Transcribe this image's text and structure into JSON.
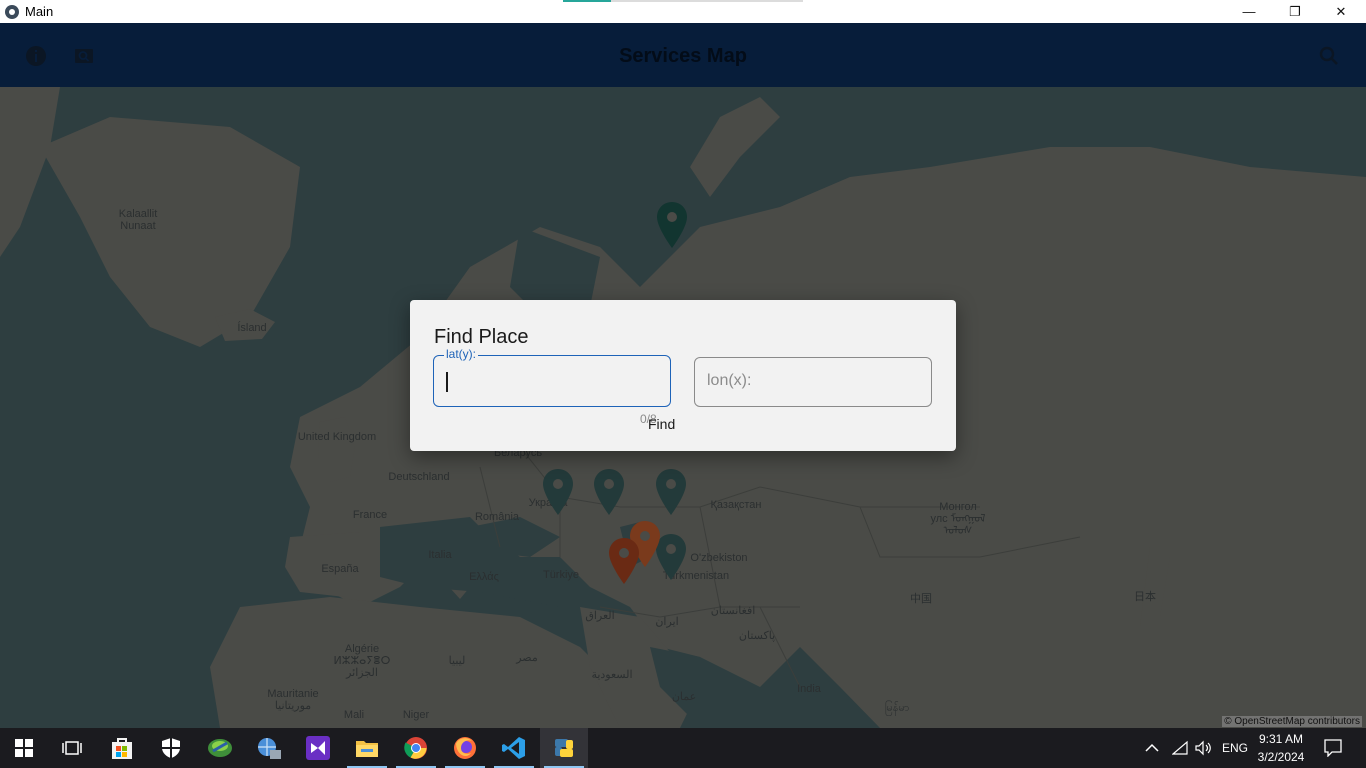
{
  "window": {
    "title": "Main",
    "progress_fraction": 0.2,
    "controls": {
      "minimize": "—",
      "maximize": "❐",
      "close": "✕"
    }
  },
  "appbar": {
    "title": "Services Map",
    "icons": [
      "info-icon",
      "screenshot-search-icon",
      "search-icon"
    ]
  },
  "map": {
    "attribution": "© OpenStreetMap contributors",
    "labels": [
      {
        "text": "Kalaallit\nNunaat"
      },
      {
        "text": "Ísland"
      },
      {
        "text": "United Kingdom"
      },
      {
        "text": "Беларусь"
      },
      {
        "text": "Deutschland"
      },
      {
        "text": "Україна"
      },
      {
        "text": "France"
      },
      {
        "text": "România"
      },
      {
        "text": "Italia"
      },
      {
        "text": "España"
      },
      {
        "text": "Ελλάς"
      },
      {
        "text": "Türkiye"
      },
      {
        "text": "Қазақстан"
      },
      {
        "text": "O'zbekiston"
      },
      {
        "text": "Turkmenistan"
      },
      {
        "text": "Монгол\nулс ᠮᠣᠩᠭᠣᠯ\nᠤᠯᠤᠰ"
      },
      {
        "text": "中国"
      },
      {
        "text": "日本"
      },
      {
        "text": "العراق"
      },
      {
        "text": "ایران"
      },
      {
        "text": "افغانستان"
      },
      {
        "text": "پاکستان"
      },
      {
        "text": "Algérie\nⵍⵣⵣⴰⵢⴻⵔ\nالجزائر"
      },
      {
        "text": "ليبيا"
      },
      {
        "text": "مصر"
      },
      {
        "text": "السعودية"
      },
      {
        "text": "Mauritanie\nموريتانيا"
      },
      {
        "text": "Mali"
      },
      {
        "text": "Niger"
      },
      {
        "text": "India"
      },
      {
        "text": "عمان"
      },
      {
        "text": "မြန်မာ"
      }
    ],
    "markers": [
      {
        "color": "#123530"
      },
      {
        "color": "#233a3a"
      },
      {
        "color": "#233a3a"
      },
      {
        "color": "#233a3a"
      },
      {
        "color": "#233a3a"
      },
      {
        "color": "#7a3a1c"
      },
      {
        "color": "#6a2a14"
      }
    ]
  },
  "dialog": {
    "title": "Find Place",
    "lat_label": "lat(y):",
    "lat_value": "",
    "lon_placeholder": "lon(x):",
    "counter": "0/8",
    "find_label": "Find"
  },
  "taskbar": {
    "apps": [
      {
        "name": "start-icon"
      },
      {
        "name": "task-view-icon"
      },
      {
        "name": "store-icon"
      },
      {
        "name": "security-icon"
      },
      {
        "name": "internet-download-manager-icon"
      },
      {
        "name": "network-tool-icon"
      },
      {
        "name": "visual-studio-icon"
      },
      {
        "name": "file-explorer-icon"
      },
      {
        "name": "chrome-icon"
      },
      {
        "name": "firefox-icon"
      },
      {
        "name": "vscode-icon"
      },
      {
        "name": "python-icon"
      }
    ],
    "language": "ENG",
    "time": "9:31 AM",
    "date": "3/2/2024"
  }
}
